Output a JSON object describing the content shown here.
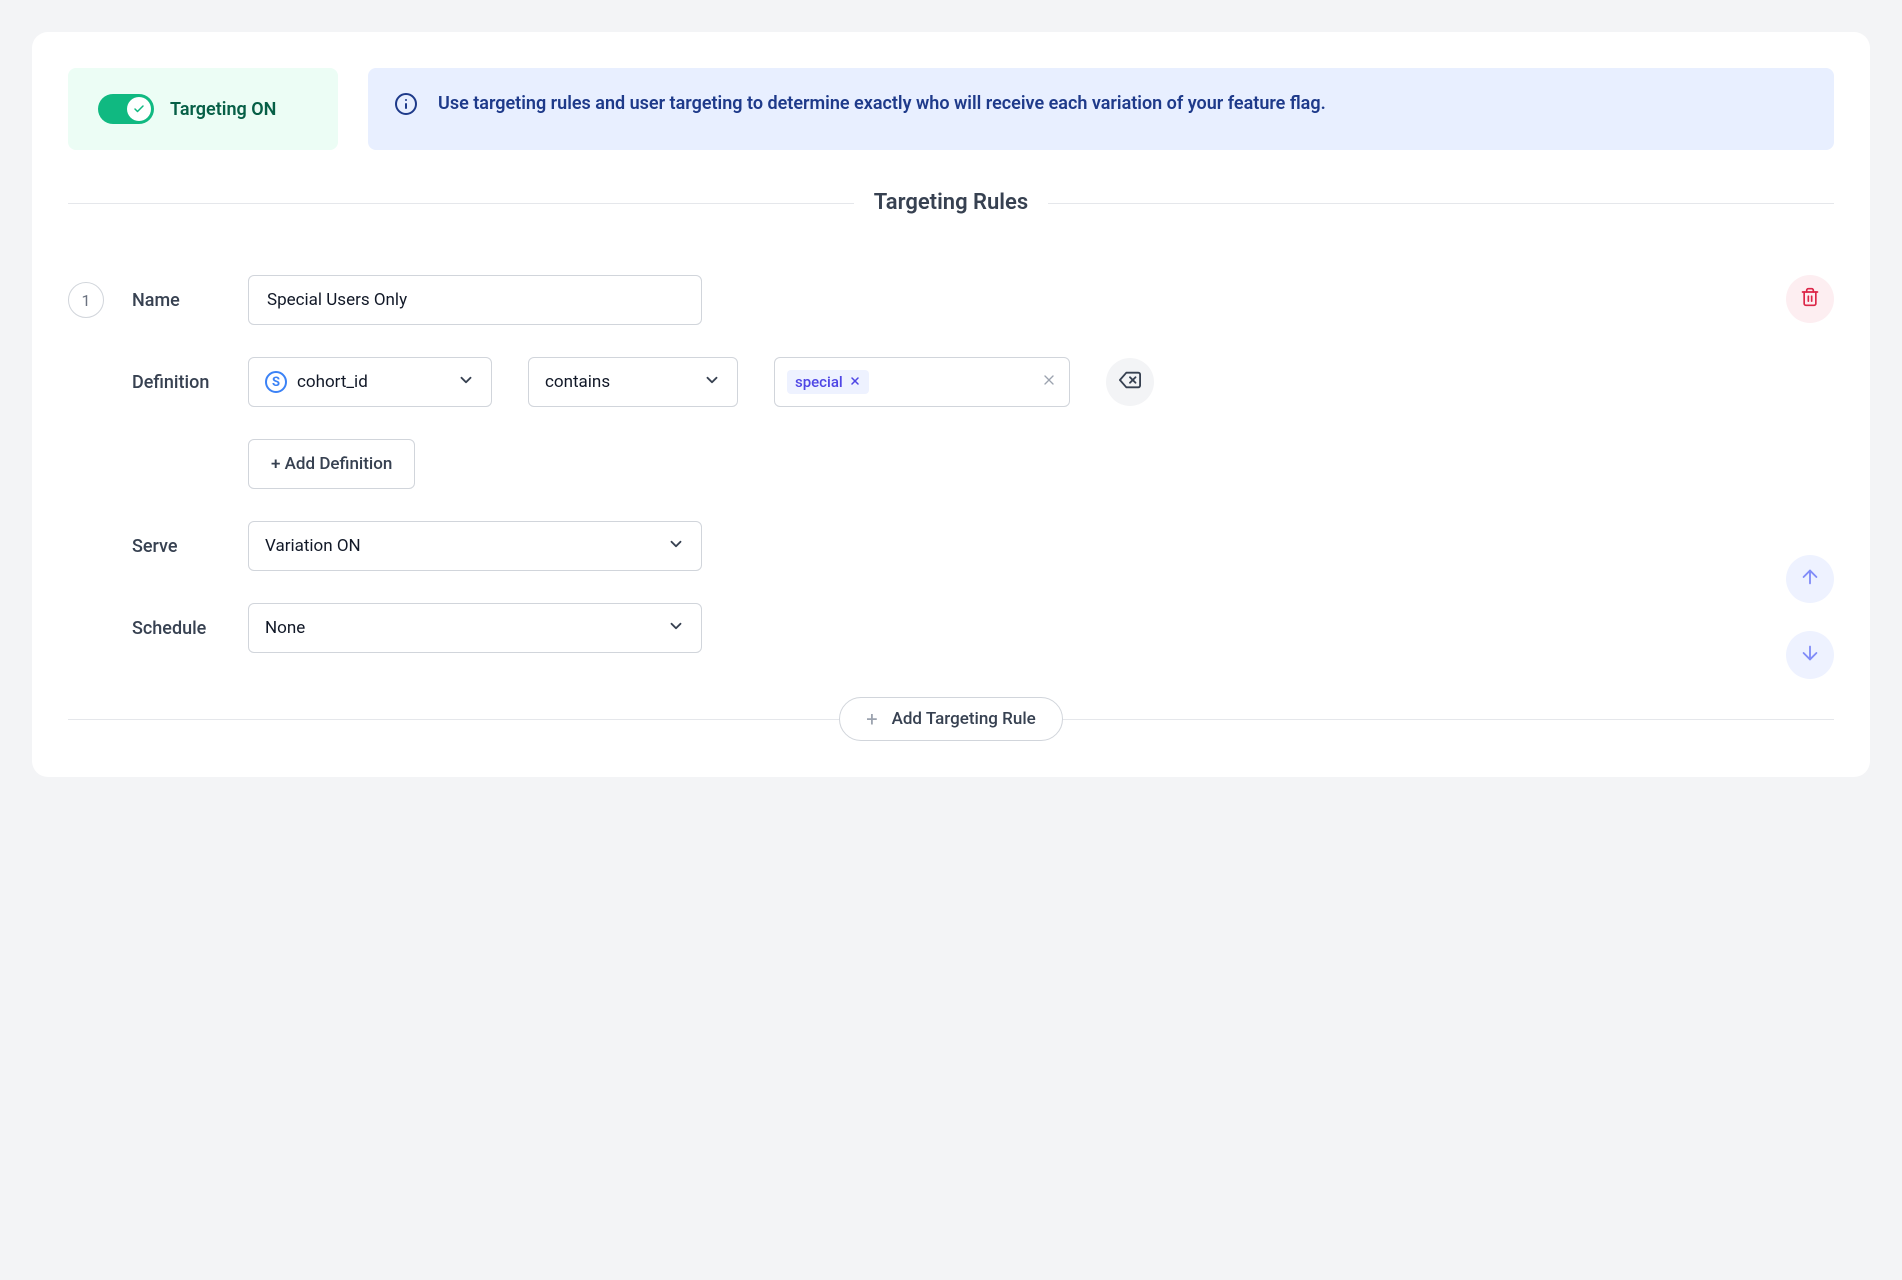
{
  "header": {
    "toggle_label": "Targeting ON",
    "info_text": "Use targeting rules and user targeting to determine exactly who will receive each variation of your feature flag."
  },
  "section_title": "Targeting Rules",
  "rule": {
    "number": "1",
    "name_label": "Name",
    "name_value": "Special Users Only",
    "definition_label": "Definition",
    "attribute_value": "cohort_id",
    "operator_value": "contains",
    "tag_value": "special",
    "add_definition_label": "+ Add Definition",
    "serve_label": "Serve",
    "serve_value": "Variation ON",
    "schedule_label": "Schedule",
    "schedule_value": "None"
  },
  "add_rule_label": "Add Targeting Rule"
}
